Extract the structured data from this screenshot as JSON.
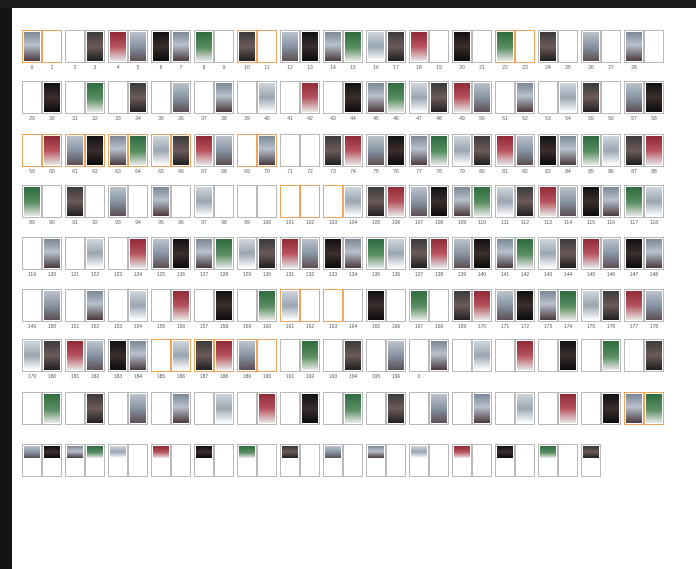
{
  "window": {
    "title": ""
  },
  "rows": [
    {
      "labels": [
        [
          0,
          "0"
        ],
        [
          1,
          "1"
        ],
        [
          2,
          "2"
        ],
        [
          3,
          "3"
        ],
        [
          4,
          "4"
        ],
        [
          5,
          "5"
        ],
        [
          6,
          "6"
        ],
        [
          7,
          "7"
        ],
        [
          8,
          "8"
        ],
        [
          9,
          "9"
        ],
        [
          10,
          "10"
        ],
        [
          11,
          "11"
        ],
        [
          12,
          "12"
        ],
        [
          13,
          "13"
        ],
        [
          14,
          "14"
        ],
        [
          15,
          "15"
        ],
        [
          16,
          "16"
        ],
        [
          17,
          "17"
        ],
        [
          18,
          "18"
        ],
        [
          19,
          "19"
        ],
        [
          20,
          "20"
        ],
        [
          21,
          "21"
        ],
        [
          22,
          "22"
        ],
        [
          23,
          "23"
        ],
        [
          24,
          "24"
        ],
        [
          25,
          "25"
        ],
        [
          26,
          "26"
        ],
        [
          27,
          "27"
        ],
        [
          28,
          "28"
        ]
      ],
      "photos": [
        0,
        3,
        4,
        5,
        6,
        7,
        8,
        10,
        12,
        13,
        14,
        15,
        16,
        17,
        18,
        20,
        22,
        24,
        26,
        28
      ],
      "selected": [
        0,
        1,
        10,
        11,
        22,
        23
      ]
    },
    {
      "labels": [
        [
          0,
          "29"
        ],
        [
          1,
          "30"
        ],
        [
          2,
          "31"
        ],
        [
          3,
          "32"
        ],
        [
          4,
          "33"
        ],
        [
          5,
          "34"
        ],
        [
          6,
          "35"
        ],
        [
          7,
          "36"
        ],
        [
          8,
          "37"
        ],
        [
          9,
          "38"
        ],
        [
          10,
          "39"
        ],
        [
          11,
          "40"
        ],
        [
          12,
          "41"
        ],
        [
          13,
          "42"
        ],
        [
          14,
          "43"
        ],
        [
          15,
          "44"
        ],
        [
          16,
          "45"
        ],
        [
          17,
          "46"
        ],
        [
          18,
          "47"
        ],
        [
          19,
          "48"
        ],
        [
          20,
          "49"
        ],
        [
          21,
          "50"
        ],
        [
          22,
          "51"
        ],
        [
          23,
          "52"
        ],
        [
          24,
          "53"
        ],
        [
          25,
          "54"
        ],
        [
          26,
          "55"
        ],
        [
          27,
          "56"
        ],
        [
          28,
          "57"
        ],
        [
          29,
          "58"
        ]
      ],
      "photos": [
        1,
        3,
        5,
        7,
        9,
        11,
        13,
        15,
        16,
        17,
        18,
        19,
        20,
        21,
        23,
        25,
        26,
        28,
        29
      ],
      "selected": []
    },
    {
      "labels": [
        [
          0,
          "59"
        ],
        [
          1,
          "60"
        ],
        [
          2,
          "61"
        ],
        [
          3,
          "62"
        ],
        [
          4,
          "63"
        ],
        [
          5,
          "64"
        ],
        [
          6,
          "65"
        ],
        [
          7,
          "66"
        ],
        [
          8,
          "67"
        ],
        [
          9,
          "68"
        ],
        [
          10,
          "69"
        ],
        [
          11,
          "70"
        ],
        [
          12,
          "71"
        ],
        [
          13,
          "72"
        ],
        [
          14,
          "73"
        ],
        [
          15,
          "74"
        ],
        [
          16,
          "75"
        ],
        [
          17,
          "76"
        ],
        [
          18,
          "77"
        ],
        [
          19,
          "78"
        ],
        [
          20,
          "79"
        ],
        [
          21,
          "80"
        ],
        [
          22,
          "81"
        ],
        [
          23,
          "82"
        ],
        [
          24,
          "83"
        ],
        [
          25,
          "84"
        ],
        [
          26,
          "85"
        ],
        [
          27,
          "86"
        ],
        [
          28,
          "87"
        ],
        [
          29,
          "88"
        ]
      ],
      "photos": [
        1,
        2,
        3,
        4,
        5,
        6,
        7,
        8,
        9,
        11,
        14,
        15,
        16,
        17,
        18,
        19,
        20,
        21,
        22,
        23,
        24,
        25,
        26,
        27,
        28,
        29
      ],
      "selected": [
        0,
        1,
        2,
        3,
        4,
        5,
        6,
        7,
        10,
        11
      ]
    },
    {
      "labels": [
        [
          0,
          "89"
        ],
        [
          1,
          "90"
        ],
        [
          2,
          "91"
        ],
        [
          3,
          "92"
        ],
        [
          4,
          "93"
        ],
        [
          5,
          "94"
        ],
        [
          6,
          "95"
        ],
        [
          7,
          "96"
        ],
        [
          8,
          "97"
        ],
        [
          9,
          "98"
        ],
        [
          10,
          "99"
        ],
        [
          11,
          "100"
        ],
        [
          12,
          "101"
        ],
        [
          13,
          "102"
        ],
        [
          14,
          "103"
        ],
        [
          15,
          "104"
        ],
        [
          16,
          "105"
        ],
        [
          17,
          "106"
        ],
        [
          18,
          "107"
        ],
        [
          19,
          "108"
        ],
        [
          20,
          "109"
        ],
        [
          21,
          "110"
        ],
        [
          22,
          "111"
        ],
        [
          23,
          "112"
        ],
        [
          24,
          "113"
        ],
        [
          25,
          "114"
        ],
        [
          26,
          "115"
        ],
        [
          27,
          "116"
        ],
        [
          28,
          "117"
        ],
        [
          29,
          "118"
        ]
      ],
      "photos": [
        0,
        2,
        4,
        6,
        8,
        15,
        16,
        17,
        18,
        19,
        20,
        21,
        22,
        23,
        24,
        25,
        26,
        27,
        28,
        29
      ],
      "selected": [
        12,
        13,
        14
      ]
    },
    {
      "labels": [
        [
          0,
          "119"
        ],
        [
          1,
          "120"
        ],
        [
          2,
          "121"
        ],
        [
          3,
          "122"
        ],
        [
          4,
          "123"
        ],
        [
          5,
          "124"
        ],
        [
          6,
          "125"
        ],
        [
          7,
          "126"
        ],
        [
          8,
          "127"
        ],
        [
          9,
          "128"
        ],
        [
          10,
          "129"
        ],
        [
          11,
          "130"
        ],
        [
          12,
          "131"
        ],
        [
          13,
          "132"
        ],
        [
          14,
          "133"
        ],
        [
          15,
          "134"
        ],
        [
          16,
          "135"
        ],
        [
          17,
          "136"
        ],
        [
          18,
          "137"
        ],
        [
          19,
          "138"
        ],
        [
          20,
          "139"
        ],
        [
          21,
          "140"
        ],
        [
          22,
          "141"
        ],
        [
          23,
          "142"
        ],
        [
          24,
          "143"
        ],
        [
          25,
          "144"
        ],
        [
          26,
          "145"
        ],
        [
          27,
          "146"
        ],
        [
          28,
          "147"
        ],
        [
          29,
          "148"
        ]
      ],
      "photos": [
        1,
        3,
        5,
        6,
        7,
        8,
        9,
        10,
        11,
        12,
        13,
        14,
        15,
        16,
        17,
        18,
        19,
        20,
        21,
        22,
        23,
        24,
        25,
        26,
        27,
        28,
        29
      ],
      "selected": []
    },
    {
      "labels": [
        [
          0,
          "149"
        ],
        [
          1,
          "150"
        ],
        [
          2,
          "151"
        ],
        [
          3,
          "152"
        ],
        [
          4,
          "153"
        ],
        [
          5,
          "154"
        ],
        [
          6,
          "155"
        ],
        [
          7,
          "156"
        ],
        [
          8,
          "157"
        ],
        [
          9,
          "158"
        ],
        [
          10,
          "159"
        ],
        [
          11,
          "160"
        ],
        [
          12,
          "161"
        ],
        [
          13,
          "162"
        ],
        [
          14,
          "163"
        ],
        [
          15,
          "164"
        ],
        [
          16,
          "165"
        ],
        [
          17,
          "166"
        ],
        [
          18,
          "167"
        ],
        [
          19,
          "168"
        ],
        [
          20,
          "169"
        ],
        [
          21,
          "170"
        ],
        [
          22,
          "171"
        ],
        [
          23,
          "172"
        ],
        [
          24,
          "173"
        ],
        [
          25,
          "174"
        ],
        [
          26,
          "175"
        ],
        [
          27,
          "176"
        ],
        [
          28,
          "177"
        ],
        [
          29,
          "178"
        ]
      ],
      "photos": [
        1,
        3,
        5,
        7,
        9,
        11,
        12,
        16,
        18,
        20,
        21,
        22,
        23,
        24,
        25,
        26,
        27,
        28,
        29
      ],
      "selected": [
        12,
        13,
        14
      ]
    },
    {
      "labels": [
        [
          0,
          "179"
        ],
        [
          1,
          "180"
        ],
        [
          2,
          "181"
        ],
        [
          3,
          "182"
        ],
        [
          4,
          "183"
        ],
        [
          5,
          "184"
        ],
        [
          6,
          "185"
        ],
        [
          7,
          "186"
        ],
        [
          8,
          "187"
        ],
        [
          9,
          "188"
        ],
        [
          10,
          "189"
        ],
        [
          11,
          "190"
        ],
        [
          12,
          "191"
        ],
        [
          13,
          "192"
        ],
        [
          14,
          "193"
        ],
        [
          15,
          "194"
        ],
        [
          16,
          "195"
        ],
        [
          17,
          "196"
        ],
        [
          18,
          "0"
        ]
      ],
      "photos": [
        0,
        1,
        2,
        3,
        4,
        5,
        7,
        8,
        9,
        10,
        13,
        15,
        17,
        19,
        21,
        23,
        25,
        27,
        29
      ],
      "selected": [
        6,
        7,
        8,
        9,
        10,
        11
      ]
    },
    {
      "labels": [],
      "photos": [
        1,
        3,
        5,
        7,
        9,
        11,
        13,
        15,
        17,
        19,
        21,
        23,
        25,
        27,
        28,
        29
      ],
      "selected": [
        28,
        29
      ]
    },
    {
      "labels": [],
      "photos": [
        0,
        1,
        2,
        3,
        4,
        6,
        8,
        10,
        12,
        14,
        16,
        18,
        20,
        22,
        24,
        26
      ],
      "selected": []
    }
  ]
}
